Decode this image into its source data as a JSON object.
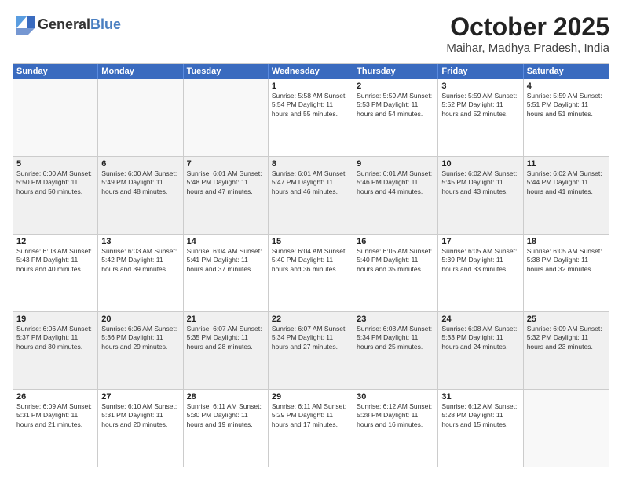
{
  "logo": {
    "general": "General",
    "blue": "Blue"
  },
  "header": {
    "month": "October 2025",
    "location": "Maihar, Madhya Pradesh, India"
  },
  "weekdays": [
    "Sunday",
    "Monday",
    "Tuesday",
    "Wednesday",
    "Thursday",
    "Friday",
    "Saturday"
  ],
  "rows": [
    [
      {
        "day": "",
        "info": "",
        "empty": true
      },
      {
        "day": "",
        "info": "",
        "empty": true
      },
      {
        "day": "",
        "info": "",
        "empty": true
      },
      {
        "day": "1",
        "info": "Sunrise: 5:58 AM\nSunset: 5:54 PM\nDaylight: 11 hours\nand 55 minutes."
      },
      {
        "day": "2",
        "info": "Sunrise: 5:59 AM\nSunset: 5:53 PM\nDaylight: 11 hours\nand 54 minutes."
      },
      {
        "day": "3",
        "info": "Sunrise: 5:59 AM\nSunset: 5:52 PM\nDaylight: 11 hours\nand 52 minutes."
      },
      {
        "day": "4",
        "info": "Sunrise: 5:59 AM\nSunset: 5:51 PM\nDaylight: 11 hours\nand 51 minutes."
      }
    ],
    [
      {
        "day": "5",
        "info": "Sunrise: 6:00 AM\nSunset: 5:50 PM\nDaylight: 11 hours\nand 50 minutes.",
        "shaded": true
      },
      {
        "day": "6",
        "info": "Sunrise: 6:00 AM\nSunset: 5:49 PM\nDaylight: 11 hours\nand 48 minutes.",
        "shaded": true
      },
      {
        "day": "7",
        "info": "Sunrise: 6:01 AM\nSunset: 5:48 PM\nDaylight: 11 hours\nand 47 minutes.",
        "shaded": true
      },
      {
        "day": "8",
        "info": "Sunrise: 6:01 AM\nSunset: 5:47 PM\nDaylight: 11 hours\nand 46 minutes.",
        "shaded": true
      },
      {
        "day": "9",
        "info": "Sunrise: 6:01 AM\nSunset: 5:46 PM\nDaylight: 11 hours\nand 44 minutes.",
        "shaded": true
      },
      {
        "day": "10",
        "info": "Sunrise: 6:02 AM\nSunset: 5:45 PM\nDaylight: 11 hours\nand 43 minutes.",
        "shaded": true
      },
      {
        "day": "11",
        "info": "Sunrise: 6:02 AM\nSunset: 5:44 PM\nDaylight: 11 hours\nand 41 minutes.",
        "shaded": true
      }
    ],
    [
      {
        "day": "12",
        "info": "Sunrise: 6:03 AM\nSunset: 5:43 PM\nDaylight: 11 hours\nand 40 minutes."
      },
      {
        "day": "13",
        "info": "Sunrise: 6:03 AM\nSunset: 5:42 PM\nDaylight: 11 hours\nand 39 minutes."
      },
      {
        "day": "14",
        "info": "Sunrise: 6:04 AM\nSunset: 5:41 PM\nDaylight: 11 hours\nand 37 minutes."
      },
      {
        "day": "15",
        "info": "Sunrise: 6:04 AM\nSunset: 5:40 PM\nDaylight: 11 hours\nand 36 minutes."
      },
      {
        "day": "16",
        "info": "Sunrise: 6:05 AM\nSunset: 5:40 PM\nDaylight: 11 hours\nand 35 minutes."
      },
      {
        "day": "17",
        "info": "Sunrise: 6:05 AM\nSunset: 5:39 PM\nDaylight: 11 hours\nand 33 minutes."
      },
      {
        "day": "18",
        "info": "Sunrise: 6:05 AM\nSunset: 5:38 PM\nDaylight: 11 hours\nand 32 minutes."
      }
    ],
    [
      {
        "day": "19",
        "info": "Sunrise: 6:06 AM\nSunset: 5:37 PM\nDaylight: 11 hours\nand 30 minutes.",
        "shaded": true
      },
      {
        "day": "20",
        "info": "Sunrise: 6:06 AM\nSunset: 5:36 PM\nDaylight: 11 hours\nand 29 minutes.",
        "shaded": true
      },
      {
        "day": "21",
        "info": "Sunrise: 6:07 AM\nSunset: 5:35 PM\nDaylight: 11 hours\nand 28 minutes.",
        "shaded": true
      },
      {
        "day": "22",
        "info": "Sunrise: 6:07 AM\nSunset: 5:34 PM\nDaylight: 11 hours\nand 27 minutes.",
        "shaded": true
      },
      {
        "day": "23",
        "info": "Sunrise: 6:08 AM\nSunset: 5:34 PM\nDaylight: 11 hours\nand 25 minutes.",
        "shaded": true
      },
      {
        "day": "24",
        "info": "Sunrise: 6:08 AM\nSunset: 5:33 PM\nDaylight: 11 hours\nand 24 minutes.",
        "shaded": true
      },
      {
        "day": "25",
        "info": "Sunrise: 6:09 AM\nSunset: 5:32 PM\nDaylight: 11 hours\nand 23 minutes.",
        "shaded": true
      }
    ],
    [
      {
        "day": "26",
        "info": "Sunrise: 6:09 AM\nSunset: 5:31 PM\nDaylight: 11 hours\nand 21 minutes."
      },
      {
        "day": "27",
        "info": "Sunrise: 6:10 AM\nSunset: 5:31 PM\nDaylight: 11 hours\nand 20 minutes."
      },
      {
        "day": "28",
        "info": "Sunrise: 6:11 AM\nSunset: 5:30 PM\nDaylight: 11 hours\nand 19 minutes."
      },
      {
        "day": "29",
        "info": "Sunrise: 6:11 AM\nSunset: 5:29 PM\nDaylight: 11 hours\nand 17 minutes."
      },
      {
        "day": "30",
        "info": "Sunrise: 6:12 AM\nSunset: 5:28 PM\nDaylight: 11 hours\nand 16 minutes."
      },
      {
        "day": "31",
        "info": "Sunrise: 6:12 AM\nSunset: 5:28 PM\nDaylight: 11 hours\nand 15 minutes."
      },
      {
        "day": "",
        "info": "",
        "empty": true
      }
    ]
  ]
}
